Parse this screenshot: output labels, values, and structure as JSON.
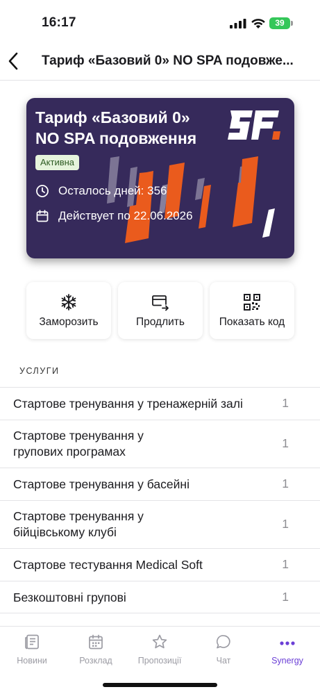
{
  "status_bar": {
    "time": "16:17",
    "battery": "39"
  },
  "header": {
    "title": "Тариф «Базовий 0»  NO SPA подовже..."
  },
  "card": {
    "title_line1": "Тариф «Базовий 0»",
    "title_line2": "NO SPA подовження",
    "status": "Активна",
    "days_left": "Осталось дней: 356",
    "valid_until": "Действует по 22.06.2026",
    "logo": "logo-SF",
    "colors": {
      "background": "#362a5b",
      "accent": "#ea5b1d"
    }
  },
  "actions": [
    {
      "label": "Заморозить",
      "icon": "snowflake-icon"
    },
    {
      "label": "Продлить",
      "icon": "card-renew-icon"
    },
    {
      "label": "Показать код",
      "icon": "qr-code-icon"
    }
  ],
  "services_header": "УСЛУГИ",
  "services": [
    {
      "line1": "Стартове тренування у тренажерній залі",
      "line2": "",
      "count": "1"
    },
    {
      "line1": "Стартове тренування у",
      "line2": "групових програмах",
      "count": "1"
    },
    {
      "line1": "Стартове тренування у басейні",
      "line2": "",
      "count": "1"
    },
    {
      "line1": "Стартове тренування у",
      "line2": "бійцівському клубі",
      "count": "1"
    },
    {
      "line1": "Стартове тестування Medical Soft",
      "line2": "",
      "count": "1"
    },
    {
      "line1": "Безкоштовні групові",
      "line2": "",
      "count": "1"
    }
  ],
  "tabs": [
    {
      "label": "Новини",
      "icon": "news-icon"
    },
    {
      "label": "Розклад",
      "icon": "calendar-icon"
    },
    {
      "label": "Пропозиції",
      "icon": "star-icon"
    },
    {
      "label": "Чат",
      "icon": "chat-icon"
    },
    {
      "label": "Synergy",
      "icon": "more-icon",
      "active": true
    }
  ],
  "colors": {
    "accent": "#6b3fd6",
    "badge_bg": "#e6f4dc"
  }
}
